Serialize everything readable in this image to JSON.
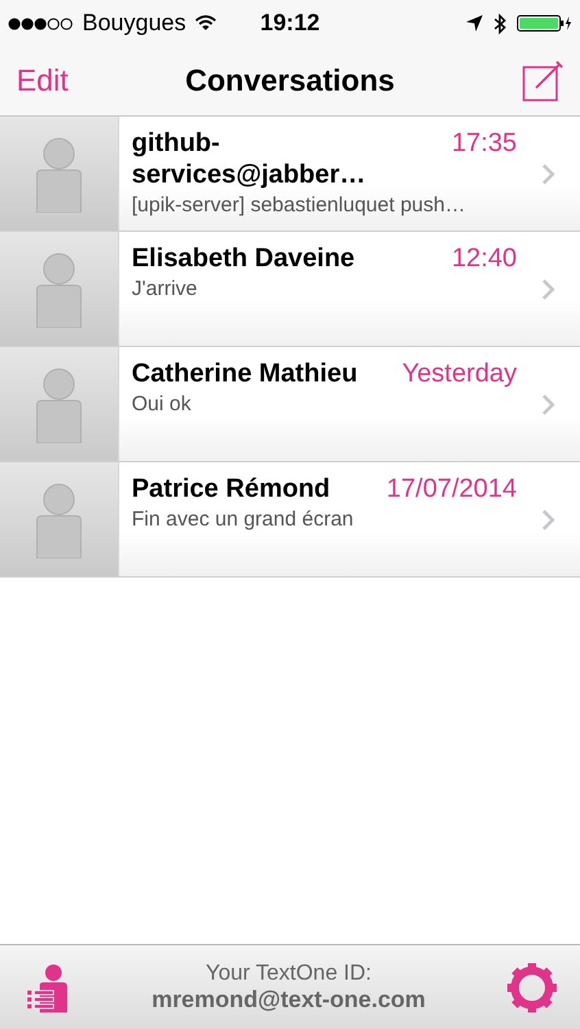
{
  "status_bar": {
    "carrier": "Bouygues",
    "time": "19:12"
  },
  "nav_bar": {
    "left_button": "Edit",
    "title": "Conversations"
  },
  "conversations": [
    {
      "name": "github-services@jabber…",
      "time": "17:35",
      "preview": "[upik-server] sebastienluquet push…"
    },
    {
      "name": "Elisabeth Daveine",
      "time": "12:40",
      "preview": "J'arrive"
    },
    {
      "name": "Catherine Mathieu",
      "time": "Yesterday",
      "preview": "Oui ok"
    },
    {
      "name": "Patrice Rémond",
      "time": "17/07/2014",
      "preview": "Fin avec un grand écran"
    }
  ],
  "footer": {
    "label": "Your TextOne ID:",
    "user_id": "mremond@text-one.com"
  }
}
